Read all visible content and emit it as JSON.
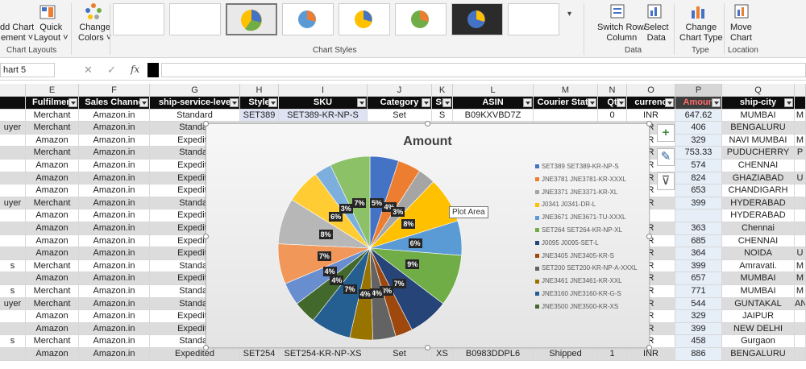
{
  "ribbon": {
    "add_chart_element": [
      "dd Chart",
      "ement ˅"
    ],
    "quick_layout": [
      "Quick",
      "Layout ˅"
    ],
    "change_colors": [
      "Change",
      "Colors ˅"
    ],
    "chart_layouts_label": "Chart Layouts",
    "chart_styles_label": "Chart Styles",
    "switch_row_col": [
      "Switch Row/",
      "Column"
    ],
    "select_data": [
      "Select",
      "Data"
    ],
    "data_label": "Data",
    "change_chart_type": [
      "Change",
      "Chart Type"
    ],
    "type_label": "Type",
    "move_chart": [
      "Move",
      "Chart"
    ],
    "location_label": "Location"
  },
  "formula_bar": {
    "name_box": "hart 5",
    "cancel_icon": "✕",
    "enter_icon": "✓",
    "fx": "fx"
  },
  "columns": {
    "letters": [
      "",
      "E",
      "F",
      "G",
      "H",
      "I",
      "J",
      "K",
      "L",
      "M",
      "N",
      "O",
      "P",
      "Q",
      ""
    ],
    "headers": [
      "",
      "Fulfilmen",
      "Sales Channe",
      "ship-service-leve",
      "Style",
      "SKU",
      "Category",
      "Siz",
      "ASIN",
      "Courier Statu",
      "Qt",
      "currenc",
      "Amoun",
      "ship-city",
      ""
    ]
  },
  "rows": [
    [
      "",
      "Merchant",
      "Amazon.in",
      "Standard",
      "SET389",
      "SET389-KR-NP-S",
      "Set",
      "S",
      "B09KXVBD7Z",
      "",
      "0",
      "INR",
      "647.62",
      "MUMBAI",
      "M"
    ],
    [
      "uyer",
      "Merchant",
      "Amazon.in",
      "Standar",
      "",
      "",
      "",
      "",
      "",
      "",
      "",
      "R",
      "406",
      "BENGALURU",
      ""
    ],
    [
      "",
      "Amazon",
      "Amazon.in",
      "Expedite",
      "",
      "",
      "",
      "",
      "",
      "",
      "",
      "R",
      "329",
      "NAVI MUMBAI",
      "M"
    ],
    [
      "",
      "Merchant",
      "Amazon.in",
      "Standar",
      "",
      "",
      "",
      "",
      "",
      "",
      "",
      "R",
      "753.33",
      "PUDUCHERRY",
      "P"
    ],
    [
      "",
      "Amazon",
      "Amazon.in",
      "Expedite",
      "",
      "",
      "",
      "",
      "",
      "",
      "",
      "R",
      "574",
      "CHENNAI",
      ""
    ],
    [
      "",
      "Amazon",
      "Amazon.in",
      "Expedite",
      "",
      "",
      "",
      "",
      "",
      "",
      "",
      "R",
      "824",
      "GHAZIABAD",
      "U"
    ],
    [
      "",
      "Amazon",
      "Amazon.in",
      "Expedite",
      "",
      "",
      "",
      "",
      "",
      "",
      "",
      "R",
      "653",
      "CHANDIGARH",
      ""
    ],
    [
      "uyer",
      "Merchant",
      "Amazon.in",
      "Standar",
      "",
      "",
      "",
      "",
      "",
      "",
      "",
      "R",
      "399",
      "HYDERABAD",
      ""
    ],
    [
      "",
      "Amazon",
      "Amazon.in",
      "Expedite",
      "",
      "",
      "",
      "",
      "",
      "",
      "",
      "",
      "",
      "HYDERABAD",
      ""
    ],
    [
      "",
      "Amazon",
      "Amazon.in",
      "Expedite",
      "",
      "",
      "",
      "",
      "",
      "",
      "",
      "R",
      "363",
      "Chennai",
      ""
    ],
    [
      "",
      "Amazon",
      "Amazon.in",
      "Expedite",
      "",
      "",
      "",
      "",
      "",
      "",
      "",
      "R",
      "685",
      "CHENNAI",
      ""
    ],
    [
      "",
      "Amazon",
      "Amazon.in",
      "Expedite",
      "",
      "",
      "",
      "",
      "",
      "",
      "",
      "R",
      "364",
      "NOIDA",
      "U"
    ],
    [
      "s",
      "Merchant",
      "Amazon.in",
      "Standar",
      "",
      "",
      "",
      "",
      "",
      "",
      "",
      "R",
      "399",
      "Amravati.",
      "M"
    ],
    [
      "",
      "Amazon",
      "Amazon.in",
      "Expedite",
      "",
      "",
      "",
      "",
      "",
      "",
      "",
      "R",
      "657",
      "MUMBAI",
      "M"
    ],
    [
      "s",
      "Merchant",
      "Amazon.in",
      "Standar",
      "",
      "",
      "",
      "",
      "",
      "",
      "",
      "R",
      "771",
      "MUMBAI",
      "M"
    ],
    [
      "uyer",
      "Merchant",
      "Amazon.in",
      "Standar",
      "",
      "",
      "",
      "",
      "",
      "",
      "",
      "R",
      "544",
      "GUNTAKAL",
      "AN"
    ],
    [
      "",
      "Amazon",
      "Amazon.in",
      "Expedite",
      "",
      "",
      "",
      "",
      "",
      "",
      "",
      "R",
      "329",
      "JAIPUR",
      ""
    ],
    [
      "",
      "Amazon",
      "Amazon.in",
      "Expedite",
      "",
      "",
      "",
      "",
      "",
      "",
      "",
      "R",
      "399",
      "NEW DELHI",
      ""
    ],
    [
      "s",
      "Merchant",
      "Amazon.in",
      "Standar",
      "",
      "",
      "",
      "",
      "",
      "",
      "",
      "R",
      "458",
      "Gurgaon",
      ""
    ],
    [
      "",
      "Amazon",
      "Amazon.in",
      "Expedited",
      "SET254",
      "SET254-KR-NP-XS",
      "Set",
      "XS",
      "B0983DDPL6",
      "Shipped",
      "1",
      "INR",
      "886",
      "BENGALURU",
      ""
    ]
  ],
  "chart": {
    "title": "Amount",
    "plot_area_tooltip": "Plot Area"
  },
  "chart_data": {
    "type": "pie",
    "title": "Amount",
    "legend_position": "right",
    "legend": [
      {
        "name": "SET389 SET389-KR-NP-S",
        "color": "#4472c4"
      },
      {
        "name": "JNE3781 JNE3781-KR-XXXL",
        "color": "#ed7d31"
      },
      {
        "name": "JNE3371 JNE3371-KR-XL",
        "color": "#a5a5a5"
      },
      {
        "name": "J0341 J0341-DR-L",
        "color": "#ffc000"
      },
      {
        "name": "JNE3671 JNE3671-TU-XXXL",
        "color": "#5b9bd5"
      },
      {
        "name": "SET264 SET264-KR-NP-XL",
        "color": "#70ad47"
      },
      {
        "name": "J0095 J0095-SET-L",
        "color": "#264478"
      },
      {
        "name": "JNE3405 JNE3405-KR-S",
        "color": "#9e480e"
      },
      {
        "name": "SET200 SET200-KR-NP-A-XXXL",
        "color": "#636363"
      },
      {
        "name": "JNE3461 JNE3461-KR-XXL",
        "color": "#997300"
      },
      {
        "name": "JNE3160 JNE3160-KR-G-S",
        "color": "#255e91"
      },
      {
        "name": "JNE3500 JNE3500-KR-XS",
        "color": "#43682b"
      }
    ],
    "slices": [
      {
        "value": 5,
        "color": "#4472c4"
      },
      {
        "value": 4,
        "color": "#ed7d31"
      },
      {
        "value": 3,
        "color": "#a5a5a5"
      },
      {
        "value": 8,
        "color": "#ffc000"
      },
      {
        "value": 6,
        "color": "#5b9bd5"
      },
      {
        "value": 9,
        "color": "#70ad47"
      },
      {
        "value": 7,
        "color": "#264478"
      },
      {
        "value": 3,
        "color": "#9e480e"
      },
      {
        "value": 4,
        "color": "#636363"
      },
      {
        "value": 4,
        "color": "#997300"
      },
      {
        "value": 7,
        "color": "#255e91"
      },
      {
        "value": 4,
        "color": "#43682b"
      },
      {
        "value": 4,
        "color": "#698ed0"
      },
      {
        "value": 7,
        "color": "#f1975a"
      },
      {
        "value": 8,
        "color": "#b7b7b7"
      },
      {
        "value": 6,
        "color": "#ffcd33"
      },
      {
        "value": 3,
        "color": "#7cafdd"
      },
      {
        "value": 7,
        "color": "#8cc168"
      }
    ],
    "data_labels": [
      "5%",
      "4%",
      "3%",
      "8%",
      "6%",
      "9%",
      "7%",
      "3%",
      "4%",
      "4%",
      "7%",
      "4%",
      "4%",
      "7%",
      "8%",
      "6%",
      "3%",
      "7%"
    ]
  },
  "sidebar_tools": {
    "add": "+",
    "brush": "✎",
    "filter": "⊽"
  }
}
